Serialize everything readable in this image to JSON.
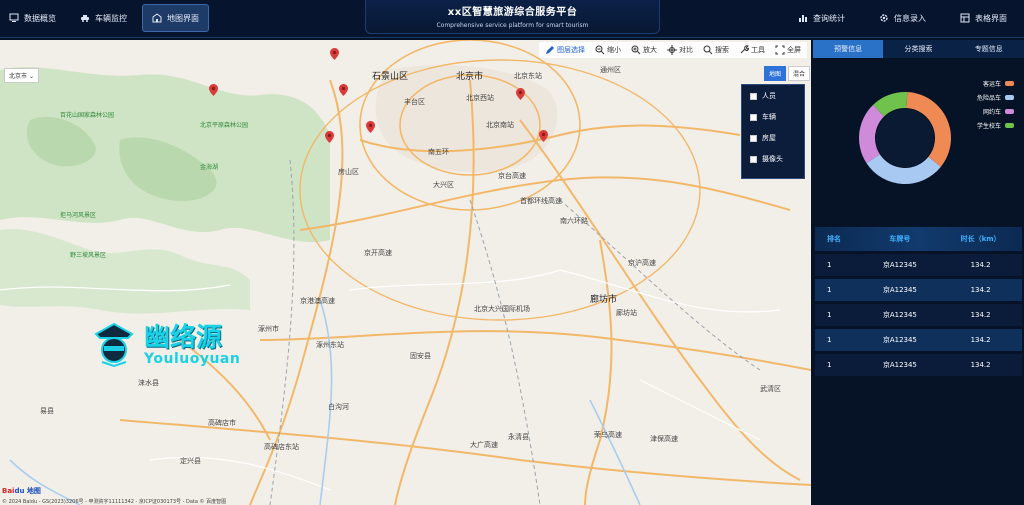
{
  "header": {
    "title": "xx区智慧旅游综合服务平台",
    "subtitle": "Comprehensive service platform for smart tourism",
    "nav_left": [
      {
        "label": "数据概览",
        "icon": "dashboard-icon"
      },
      {
        "label": "车辆监控",
        "icon": "car-icon"
      },
      {
        "label": "地图界面",
        "icon": "map-building-icon",
        "active": true
      }
    ],
    "nav_right": [
      {
        "label": "查询统计",
        "icon": "bar-chart-icon"
      },
      {
        "label": "信息录入",
        "icon": "gear-icon"
      },
      {
        "label": "表格界面",
        "icon": "table-icon"
      }
    ]
  },
  "map": {
    "toolbar": [
      "图层选择",
      "缩小",
      "放大",
      "对比",
      "搜索",
      "工具",
      "全屏"
    ],
    "city": "北京市",
    "map_types": [
      "地图",
      "混合"
    ],
    "layers": [
      "人员",
      "车辆",
      "房屋",
      "摄像头"
    ],
    "labels": {
      "beijing": "北京市",
      "shijingshan": "石景山区",
      "fengtai": "丰台区",
      "langfang": "廊坊市",
      "zhuozhou": "涿州市",
      "gu_an": "固安县",
      "daxing": "大兴区",
      "fangshan": "房山区",
      "nanwuhuan": "南五环",
      "yongqing": "永清县",
      "wuqing": "武清区",
      "laishui": "涞水县",
      "yixian": "易县",
      "gaobeidian": "高碑店市",
      "dingxing": "定兴县",
      "zhuozhou_east": "涿州东站",
      "gaobeidian_east": "高碑店东站",
      "airport": "北京大兴国际机场",
      "langfang_station": "廊坊站",
      "beijingxi": "北京西站",
      "beijingnan": "北京南站",
      "beijingdong": "北京东站",
      "jinggang": "京港澳高速",
      "jingkai": "京开高速",
      "daguang": "大广高速",
      "jinghu": "京沪高速",
      "jingtai": "京台高速",
      "tongzhou": "通州区",
      "baitouhe": "白沟河",
      "rongwu": "荣乌高速",
      "jinbao": "津保高速",
      "nanliuhuan": "南六环路",
      "shoudu": "首都环线高速",
      "poi1": "北京平原森林公园",
      "poi2": "百花山国家森林公园",
      "poi3": "金海湖",
      "poi4": "拒马河风景区",
      "poi5": "野三坡风景区"
    },
    "copyright": "© 2024 Baidu - GS(2023)3206号 - 甲测资字11111342 - 京ICP证030173号 - Data © 百度智图",
    "baidu_logo_a": "Bai",
    "baidu_logo_b": "du 地图",
    "watermark_cn": "幽络源",
    "watermark_en": "Youluoyuan"
  },
  "panel": {
    "tabs": [
      "预警信息",
      "分类搜索",
      "专题信息"
    ],
    "active_tab": 0,
    "donut": {
      "segments": [
        {
          "name": "客运车",
          "value": 35,
          "color": "#ef8a55"
        },
        {
          "name": "危险品车",
          "value": 30,
          "color": "#a7c9f2"
        },
        {
          "name": "网约车",
          "value": 22,
          "color": "#cf8bd9"
        },
        {
          "name": "学生校车",
          "value": 13,
          "color": "#6fc24c"
        }
      ]
    },
    "table": {
      "headers": [
        "排名",
        "车牌号",
        "时长（km）"
      ],
      "rows": [
        [
          "1",
          "京A12345",
          "134.2"
        ],
        [
          "1",
          "京A12345",
          "134.2"
        ],
        [
          "1",
          "京A12345",
          "134.2"
        ],
        [
          "1",
          "京A12345",
          "134.2"
        ],
        [
          "1",
          "京A12345",
          "134.2"
        ]
      ]
    }
  }
}
